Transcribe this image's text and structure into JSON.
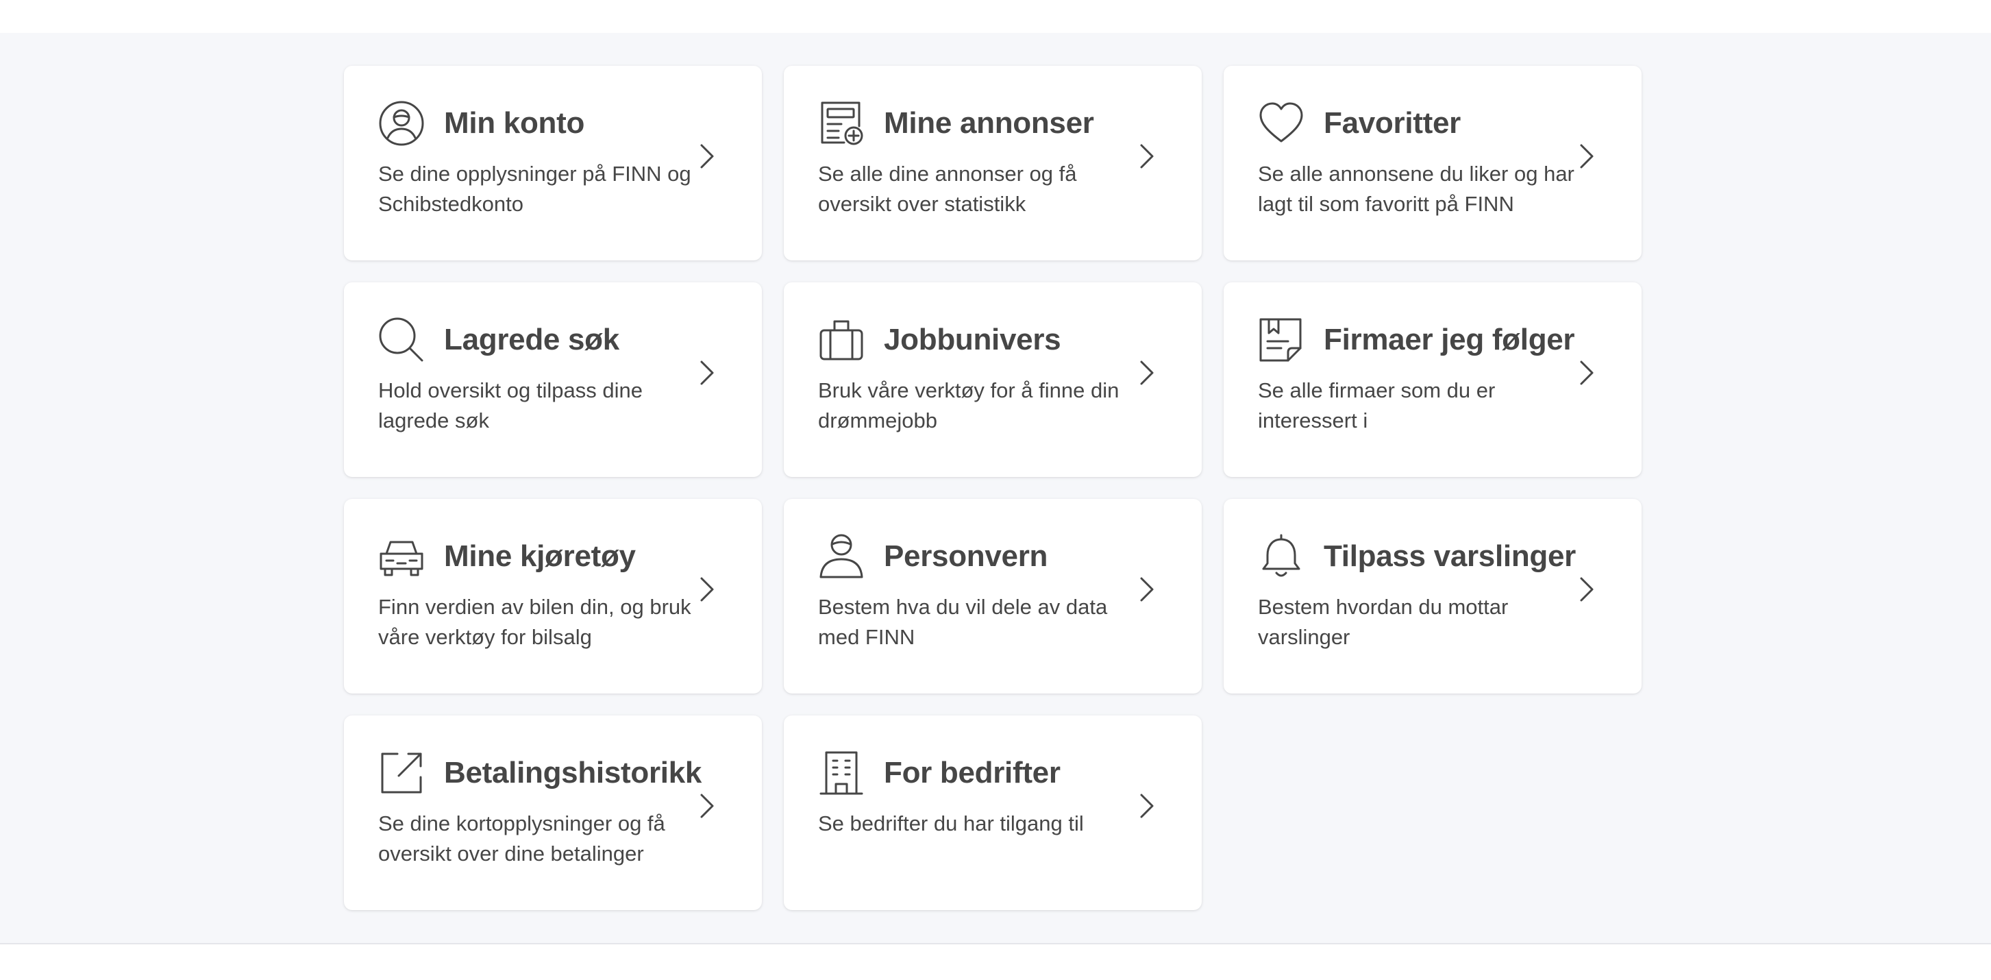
{
  "cards": [
    {
      "title": "Min konto",
      "description": "Se dine opplysninger på FINN og Schibstedkonto",
      "icon": "user-circle-icon"
    },
    {
      "title": "Mine annonser",
      "description": "Se alle dine annonser og få oversikt over statistikk",
      "icon": "ad-document-plus-icon"
    },
    {
      "title": "Favoritter",
      "description": "Se alle annonsene du liker og har lagt til som favoritt på FINN",
      "icon": "heart-icon"
    },
    {
      "title": "Lagrede søk",
      "description": "Hold oversikt og tilpass dine lagrede søk",
      "icon": "search-icon"
    },
    {
      "title": "Jobbunivers",
      "description": "Bruk våre verktøy for å finne din drømmejobb",
      "icon": "briefcase-icon"
    },
    {
      "title": "Firmaer jeg følger",
      "description": "Se alle firmaer som du er interessert i",
      "icon": "bookmark-document-icon"
    },
    {
      "title": "Mine kjøretøy",
      "description": "Finn verdien av bilen din, og bruk våre verktøy for bilsalg",
      "icon": "car-icon"
    },
    {
      "title": "Personvern",
      "description": "Bestem hva du vil dele av data med FINN",
      "icon": "person-icon"
    },
    {
      "title": "Tilpass varslinger",
      "description": "Bestem hvordan du mottar varslinger",
      "icon": "bell-icon"
    },
    {
      "title": "Betalingshistorikk",
      "description": "Se dine kortopplysninger og få oversikt over dine betalinger",
      "icon": "external-link-icon"
    },
    {
      "title": "For bedrifter",
      "description": "Se bedrifter du har tilgang til",
      "icon": "office-building-icon"
    }
  ],
  "chevron_icon": "chevron-right-icon",
  "colors": {
    "page_background": "#f6f7fa",
    "card_background": "#ffffff",
    "text": "#464646"
  }
}
